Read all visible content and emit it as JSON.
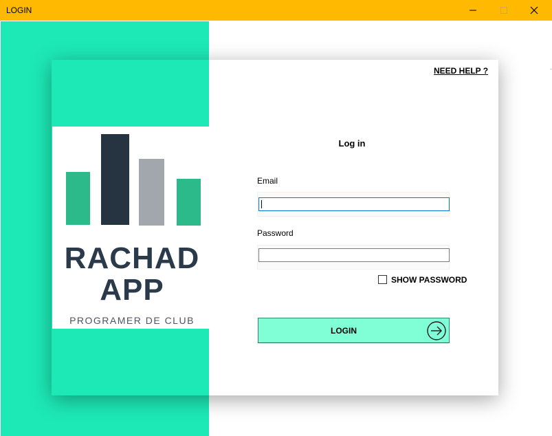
{
  "window": {
    "title": "LOGIN"
  },
  "logo": {
    "line1": "RACHAD",
    "line2": "APP",
    "subtitle": "PROGRAMER DE CLUB",
    "bar_colors": [
      "#2cba8b",
      "#263442",
      "#a1a7ad",
      "#2cba8b"
    ]
  },
  "help": {
    "label": "NEED HELP ?"
  },
  "form": {
    "title": "Log in",
    "email": {
      "label": "Email",
      "value": ""
    },
    "password": {
      "label": "Password",
      "value": ""
    },
    "show_password": {
      "label": "SHOW PASSWORD",
      "checked": false
    },
    "login_button": {
      "label": "LOGIN",
      "icon": "arrow-circle-right-icon"
    }
  },
  "colors": {
    "titlebar": "#ffb900",
    "accent": "#1de9b6",
    "button": "#80ffd6",
    "logo_text": "#2b3a4a"
  }
}
